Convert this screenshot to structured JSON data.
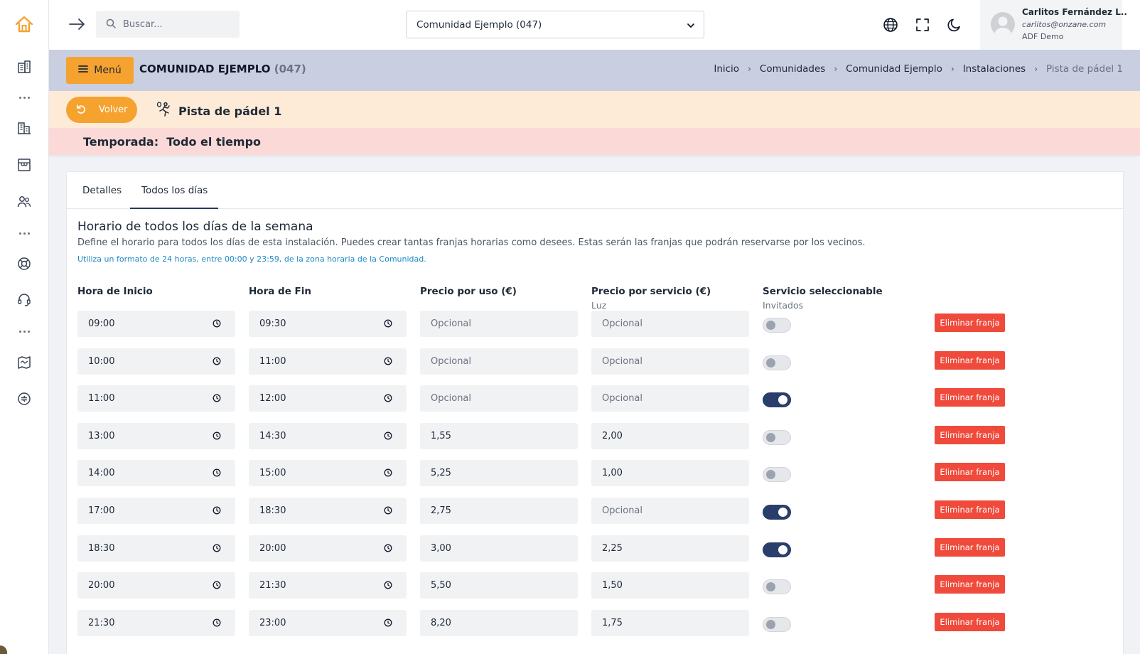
{
  "search": {
    "placeholder": "Buscar..."
  },
  "community_select": {
    "value": "Comunidad Ejemplo (047)"
  },
  "user": {
    "name": "Carlitos Fernández L..",
    "email": "carlitos@onzane.com",
    "org": "ADF Demo"
  },
  "header": {
    "menu_label": "Menú",
    "title": "COMUNIDAD EJEMPLO",
    "code": "(047)",
    "breadcrumb": [
      "Inicio",
      "Comunidades",
      "Comunidad Ejemplo",
      "Instalaciones",
      "Pista de pádel 1"
    ]
  },
  "facility": {
    "back_label": "Volver",
    "name": "Pista de pádel 1",
    "season": "Temporada:  Todo el tiempo"
  },
  "tabs": [
    {
      "label": "Detalles"
    },
    {
      "label": "Todos los días"
    }
  ],
  "section": {
    "title": "Horario de todos los días de la semana",
    "description": "Define el horario para todos los días de esta instalación. Puedes crear tantas franjas horarias como desees. Estas serán las franjas que podrán reservarse por los vecinos.",
    "hint": "Utiliza un formato de 24 horas, entre 00:00 y 23:59, de la zona horaria de la Comunidad."
  },
  "columns": {
    "start": "Hora de Inicio",
    "end": "Hora de Fin",
    "price_use": "Precio por uso (€)",
    "price_service": "Precio por servicio (€)",
    "price_service_sub": "Luz",
    "selectable": "Servicio seleccionable",
    "selectable_sub": "Invitados"
  },
  "placeholder": "Opcional",
  "delete_label": "Eliminar franja",
  "rows": [
    {
      "start": "09:00",
      "end": "09:30",
      "price_use": "",
      "price_service": "",
      "selectable": false
    },
    {
      "start": "10:00",
      "end": "11:00",
      "price_use": "",
      "price_service": "",
      "selectable": false
    },
    {
      "start": "11:00",
      "end": "12:00",
      "price_use": "",
      "price_service": "",
      "selectable": true
    },
    {
      "start": "13:00",
      "end": "14:30",
      "price_use": "1,55",
      "price_service": "2,00",
      "selectable": false
    },
    {
      "start": "14:00",
      "end": "15:00",
      "price_use": "5,25",
      "price_service": "1,00",
      "selectable": false
    },
    {
      "start": "17:00",
      "end": "18:30",
      "price_use": "2,75",
      "price_service": "",
      "selectable": true
    },
    {
      "start": "18:30",
      "end": "20:00",
      "price_use": "3,00",
      "price_service": "2,25",
      "selectable": true
    },
    {
      "start": "20:00",
      "end": "21:30",
      "price_use": "5,50",
      "price_service": "1,50",
      "selectable": false
    },
    {
      "start": "21:30",
      "end": "23:00",
      "price_use": "8,20",
      "price_service": "1,75",
      "selectable": false
    }
  ],
  "sidebar": {
    "icons": [
      "home-icon",
      "buildings-icon",
      "more-icon",
      "office-icon",
      "store-icon",
      "users-icon",
      "more-icon",
      "lifebuoy-icon",
      "headset-icon",
      "more-icon",
      "map-icon",
      "currency-icon"
    ]
  },
  "colors": {
    "accent": "#f6a22e",
    "header_band": "#c9cfe0",
    "facility_band": "#fdebd8",
    "season_band": "#fad9d6",
    "danger": "#ef4a3c",
    "toggle_on": "#293e6b"
  }
}
